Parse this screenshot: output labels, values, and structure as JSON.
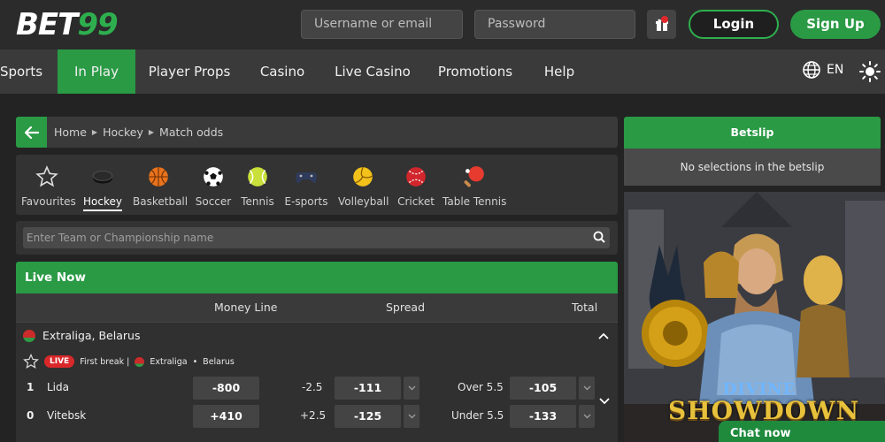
{
  "header": {
    "logo_main": "BET",
    "logo_num": "99",
    "username_placeholder": "Username or email",
    "password_placeholder": "Password",
    "gift_icon": "gift-icon",
    "login_label": "Login",
    "signup_label": "Sign Up"
  },
  "nav": {
    "items": [
      "Sports",
      "In Play",
      "Player Props",
      "Casino",
      "Live Casino",
      "Promotions",
      "Help"
    ],
    "active": "In Play",
    "language": "EN"
  },
  "breadcrumb": [
    "Home",
    "Hockey",
    "Match odds"
  ],
  "sports": {
    "items": [
      "Favourites",
      "Hockey",
      "Basketball",
      "Soccer",
      "Tennis",
      "E-sports",
      "Volleyball",
      "Cricket",
      "Table Tennis"
    ],
    "active": "Hockey"
  },
  "search": {
    "placeholder": "Enter Team or Championship name"
  },
  "live": {
    "title": "Live Now",
    "columns": [
      "Money Line",
      "Spread",
      "Total"
    ],
    "league": "Extraliga, Belarus",
    "match": {
      "status_badge": "LIVE",
      "period": "First break |",
      "league_short": "Extraliga",
      "country": "Belarus",
      "teams": [
        {
          "score": "1",
          "name": "Lida",
          "money_line": "-800",
          "spread_line": "-2.5",
          "spread_odd": "-111",
          "total_line": "Over 5.5",
          "total_odd": "-105"
        },
        {
          "score": "0",
          "name": "Vitebsk",
          "money_line": "+410",
          "spread_line": "+2.5",
          "spread_odd": "-125",
          "total_line": "Under 5.5",
          "total_odd": "-133"
        }
      ]
    }
  },
  "betslip": {
    "title": "Betslip",
    "empty_text": "No selections in the betslip"
  },
  "promo": {
    "title_top": "DIVINE",
    "title_bottom": "SHOWDOWN"
  },
  "chat": {
    "label": "Chat now"
  },
  "colors": {
    "accent": "#2a9a45",
    "live_badge": "#d8282a",
    "background": "#232323"
  }
}
